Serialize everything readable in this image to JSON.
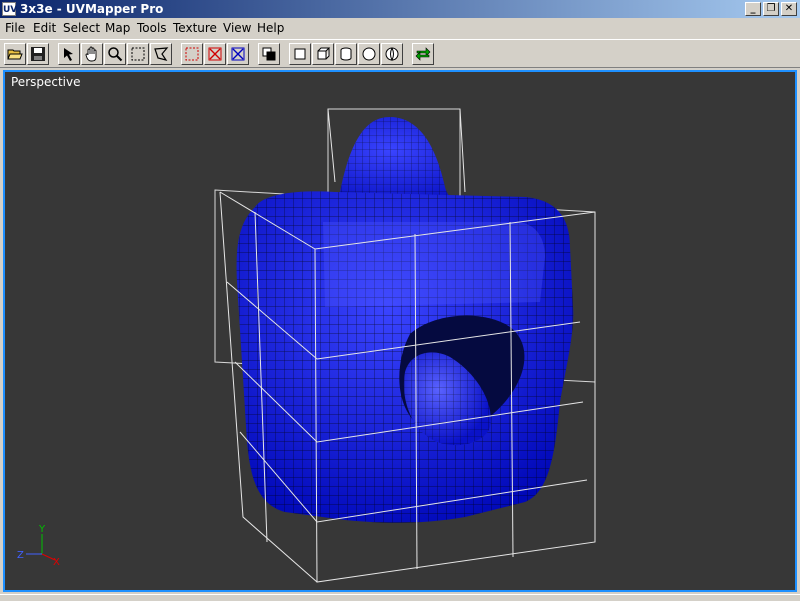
{
  "window": {
    "app_icon_text": "UV",
    "title": "3x3e - UVMapper Pro",
    "buttons": [
      {
        "name": "minimize",
        "icon": "minimize-icon",
        "glyph": "_"
      },
      {
        "name": "restore",
        "icon": "restore-icon",
        "glyph": "❐"
      },
      {
        "name": "close",
        "icon": "close-icon",
        "glyph": "✕"
      }
    ]
  },
  "menu": {
    "items": [
      "File",
      "Edit",
      "Select",
      "Map",
      "Tools",
      "Texture",
      "View",
      "Help"
    ]
  },
  "toolbar": {
    "buttons": [
      {
        "name": "open",
        "icon": "folder-open-icon"
      },
      {
        "name": "save",
        "icon": "save-icon"
      },
      {
        "name": "select-arrow",
        "icon": "arrow-icon"
      },
      {
        "name": "pan",
        "icon": "hand-icon"
      },
      {
        "name": "zoom",
        "icon": "magnifier-icon"
      },
      {
        "name": "marquee-select",
        "icon": "marquee-icon"
      },
      {
        "name": "lasso-select",
        "icon": "lasso-icon"
      },
      {
        "name": "select-none",
        "icon": "select-none-icon"
      },
      {
        "name": "deselect",
        "icon": "deselect-icon"
      },
      {
        "name": "invert-selection",
        "icon": "invert-selection-icon"
      },
      {
        "name": "copy",
        "icon": "copy-icon"
      },
      {
        "name": "map-planar",
        "icon": "planar-map-icon"
      },
      {
        "name": "map-box",
        "icon": "box-map-icon"
      },
      {
        "name": "map-cylindrical",
        "icon": "cylinder-map-icon"
      },
      {
        "name": "map-spherical",
        "icon": "sphere-map-icon"
      },
      {
        "name": "map-polar",
        "icon": "polar-map-icon"
      },
      {
        "name": "swap",
        "icon": "swap-icon"
      }
    ]
  },
  "viewport": {
    "label": "Perspective",
    "mesh_color": "#0a14e6",
    "background_color": "#373737",
    "axes": {
      "x": "X",
      "y": "Y",
      "z": "Z"
    }
  }
}
